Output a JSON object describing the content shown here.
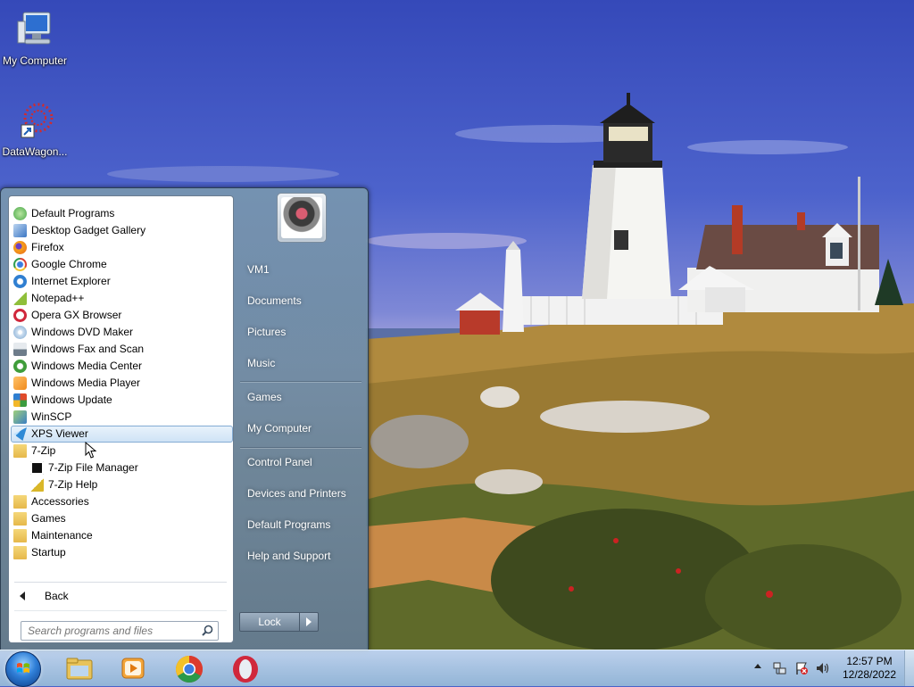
{
  "desktop": {
    "icons": [
      {
        "label": "My Computer",
        "icon": "computer-icon"
      },
      {
        "label": "DataWagon...",
        "icon": "datawagon-shortcut-icon"
      }
    ]
  },
  "start_menu": {
    "programs": [
      {
        "label": "Default Programs",
        "icon": "default-programs-icon",
        "color": "#4aa84a"
      },
      {
        "label": "Desktop Gadget Gallery",
        "icon": "gadget-gallery-icon",
        "color": "#3b76c4"
      },
      {
        "label": "Firefox",
        "icon": "firefox-icon",
        "color": "#e8641c"
      },
      {
        "label": "Google Chrome",
        "icon": "chrome-icon",
        "color": "#2a9a4a"
      },
      {
        "label": "Internet Explorer",
        "icon": "internet-explorer-icon",
        "color": "#2f7fd1"
      },
      {
        "label": "Notepad++",
        "icon": "notepad-plus-icon",
        "color": "#8fbf3a"
      },
      {
        "label": "Opera GX Browser",
        "icon": "opera-gx-icon",
        "color": "#d0283c"
      },
      {
        "label": "Windows DVD Maker",
        "icon": "dvd-maker-icon",
        "color": "#7aa5cf"
      },
      {
        "label": "Windows Fax and Scan",
        "icon": "fax-scan-icon",
        "color": "#6d7c8a"
      },
      {
        "label": "Windows Media Center",
        "icon": "media-center-icon",
        "color": "#3f9d3a"
      },
      {
        "label": "Windows Media Player",
        "icon": "media-player-icon",
        "color": "#f08a1c"
      },
      {
        "label": "Windows Update",
        "icon": "windows-update-icon",
        "color": "#3b9b3f"
      },
      {
        "label": "WinSCP",
        "icon": "winscp-icon",
        "color": "#3a7fc4"
      },
      {
        "label": "XPS Viewer",
        "icon": "xps-viewer-icon",
        "color": "#2f8ad6"
      },
      {
        "label": "7-Zip",
        "icon": "folder-icon",
        "color": "#e6b84a"
      },
      {
        "label": "7-Zip File Manager",
        "icon": "7zip-icon",
        "color": "#111111"
      },
      {
        "label": "7-Zip Help",
        "icon": "help-file-icon",
        "color": "#d9b72a"
      },
      {
        "label": "Accessories",
        "icon": "folder-icon",
        "color": "#e6b84a"
      },
      {
        "label": "Games",
        "icon": "folder-icon",
        "color": "#e6b84a"
      },
      {
        "label": "Maintenance",
        "icon": "folder-icon",
        "color": "#e6b84a"
      },
      {
        "label": "Startup",
        "icon": "folder-icon",
        "color": "#e6b84a"
      }
    ],
    "back_label": "Back",
    "search_placeholder": "Search programs and files",
    "right_items": [
      {
        "label": "VM1"
      },
      {
        "label": "Documents"
      },
      {
        "label": "Pictures"
      },
      {
        "label": "Music"
      },
      {
        "label": "Games"
      },
      {
        "label": "My Computer"
      },
      {
        "label": "Control Panel"
      },
      {
        "label": "Devices and Printers"
      },
      {
        "label": "Default Programs"
      },
      {
        "label": "Help and Support"
      }
    ],
    "lock_label": "Lock"
  },
  "taskbar": {
    "pinned": [
      {
        "icon": "windows-explorer-icon"
      },
      {
        "icon": "media-player-icon"
      },
      {
        "icon": "chrome-icon"
      },
      {
        "icon": "opera-icon"
      }
    ],
    "time": "12:57 PM",
    "date": "12/28/2022"
  }
}
